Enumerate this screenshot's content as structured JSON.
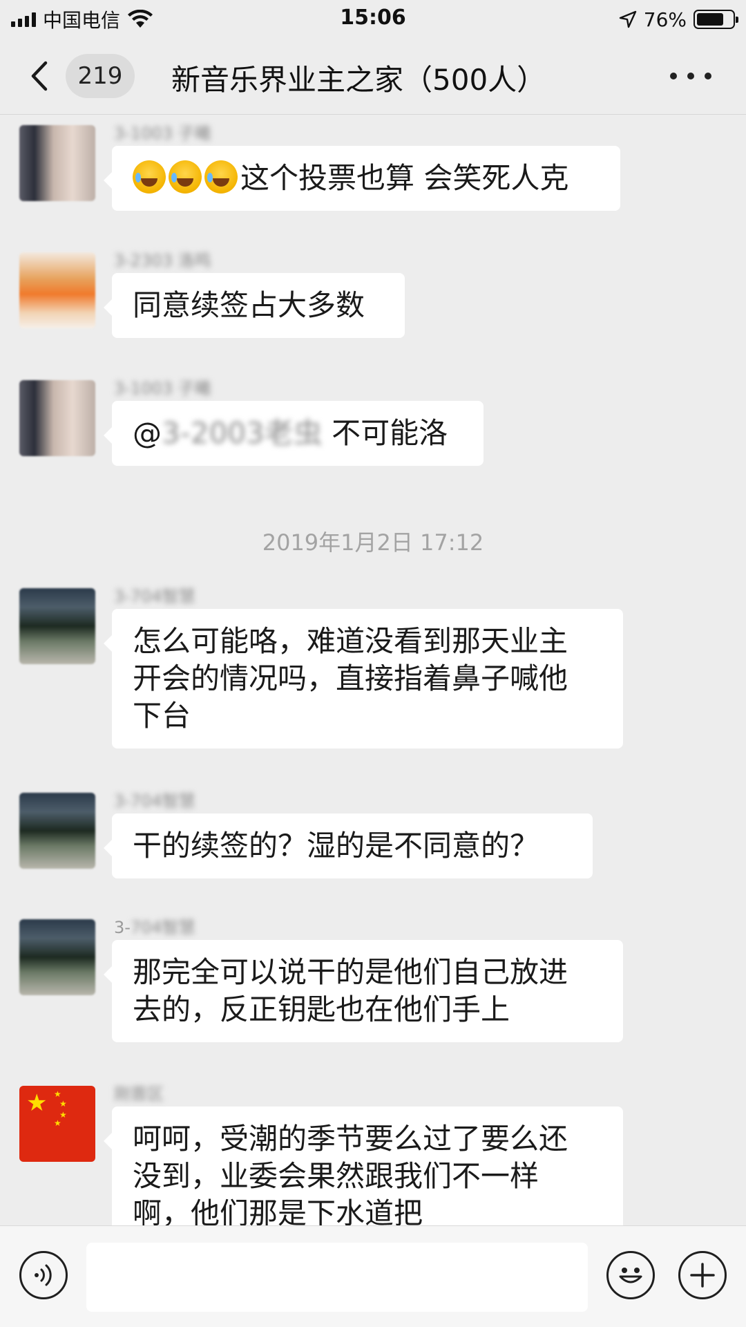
{
  "status_bar": {
    "carrier": "中国电信",
    "time": "15:06",
    "battery_percent": "76%",
    "battery_level": 0.76,
    "icons": [
      "signal-icon",
      "wifi-icon",
      "location-arrow-icon",
      "battery-icon"
    ]
  },
  "nav": {
    "unread_count": "219",
    "title": "新音乐界业主之家（500人）",
    "icons": [
      "back-chevron-icon",
      "more-dots-icon"
    ]
  },
  "messages": [
    {
      "sender": "3-1003 子曦",
      "avatar": "avatar-portrait",
      "text": "这个投票也算 会笑死人克",
      "emojis": 3
    },
    {
      "sender": "3-2303 洛鸣",
      "avatar": "avatar-orange",
      "text": "同意续签占大多数"
    },
    {
      "sender": "3-1003 子曦",
      "avatar": "avatar-portrait",
      "mention_prefix": "@",
      "mention": "3-2003老虫",
      "text": " 不可能洛"
    },
    {
      "timestamp": "2019年1月2日 17:12"
    },
    {
      "sender": "3-704智慧",
      "avatar": "avatar-landscape",
      "lines": [
        "怎么可能咯，难道没看到那天业主",
        "开会的情况吗，直接指着鼻子喊他",
        "下台"
      ]
    },
    {
      "sender": "3-704智慧",
      "avatar": "avatar-landscape",
      "text": "干的续签的？湿的是不同意的？"
    },
    {
      "sender_prefix": "3-",
      "sender": "704智慧",
      "avatar": "avatar-landscape",
      "lines": [
        "那完全可以说干的是他们自己放进",
        "去的，反正钥匙也在他们手上"
      ]
    },
    {
      "sender": "刚晋区",
      "avatar": "avatar-flag",
      "lines": [
        "呵呵，受潮的季节要么过了要么还",
        "没到，业委会果然跟我们不一样",
        "啊，他们那是下水道把"
      ]
    }
  ],
  "input_bar": {
    "icons": [
      "voice-icon",
      "emoji-face-icon",
      "plus-icon"
    ]
  }
}
